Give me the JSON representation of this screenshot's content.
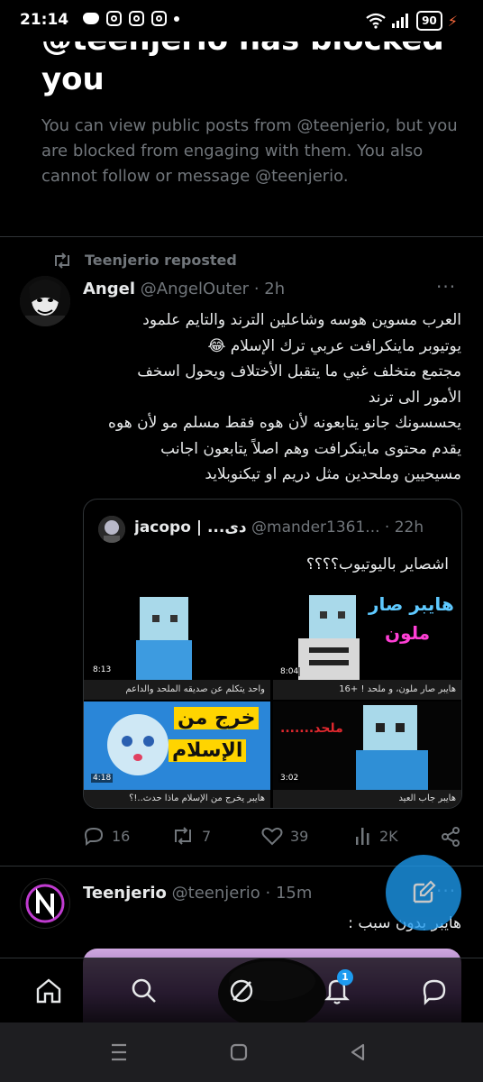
{
  "status_bar": {
    "time": "21:14",
    "battery": "90"
  },
  "blocked": {
    "title": "@teenjerio has blocked you",
    "message": "You can view public posts from @teenjerio, but you are blocked from engaging with them. You also cannot follow or message @teenjerio."
  },
  "tweet": {
    "repost_label": "Teenjerio reposted",
    "author_name": "Angel",
    "author_handle": "@AngelOuter",
    "time": "2h",
    "separator": "·",
    "lines": [
      "العرب مسوين هوسه وشاعلين الترند والتايم علمود",
      "يوتيوبر ماينكرافت عربي ترك الإسلام 😂",
      "مجتمع متخلف غبي ما يتقبل الأختلاف ويحول اسخف",
      "الأمور الى ترند",
      "يحسسونك جانو يتابعونه لأن هوه فقط مسلم مو لأن هوه",
      "يقدم محتوى ماينكرافت وهم اصلاً يتابعون اجانب",
      "مسيحيين وملحدين مثل دريم او تيكنوبلايد"
    ],
    "quote": {
      "author_name": "jacopo | ...دى",
      "author_handle": "@mander1361...",
      "time": "22h",
      "text": "اشصاير باليوتيوب؟؟؟؟",
      "videos": [
        {
          "duration": "8:13",
          "title": "واحد يتكلم عن صديقه الملحد والداعم"
        },
        {
          "duration": "8:04",
          "title": "هايبر صار ملون، و ملحد ! +16",
          "overlay1": "هايبر صار",
          "overlay2": "ملون"
        },
        {
          "duration": "4:18",
          "title": "هايبر يخرج من الإسلام ماذا حدث..!؟",
          "overlay1": "خرج من",
          "overlay2": "الإسلام"
        },
        {
          "duration": "3:02",
          "title": "هايبر جاب العيد",
          "overlay1": "ملحد......."
        }
      ]
    },
    "actions": {
      "replies": "16",
      "reposts": "7",
      "likes": "39",
      "views": "2K"
    }
  },
  "tweet2": {
    "author_name": "Teenjerio",
    "author_handle": "@teenjerio",
    "time": "15m",
    "separator": "·",
    "text": "هايبر بدون سبب :"
  },
  "bottom_nav": {
    "notification_count": "1"
  },
  "colors": {
    "accent": "#1d9bf0",
    "background": "#000000",
    "muted": "#71767b",
    "divider": "#2f3336"
  }
}
